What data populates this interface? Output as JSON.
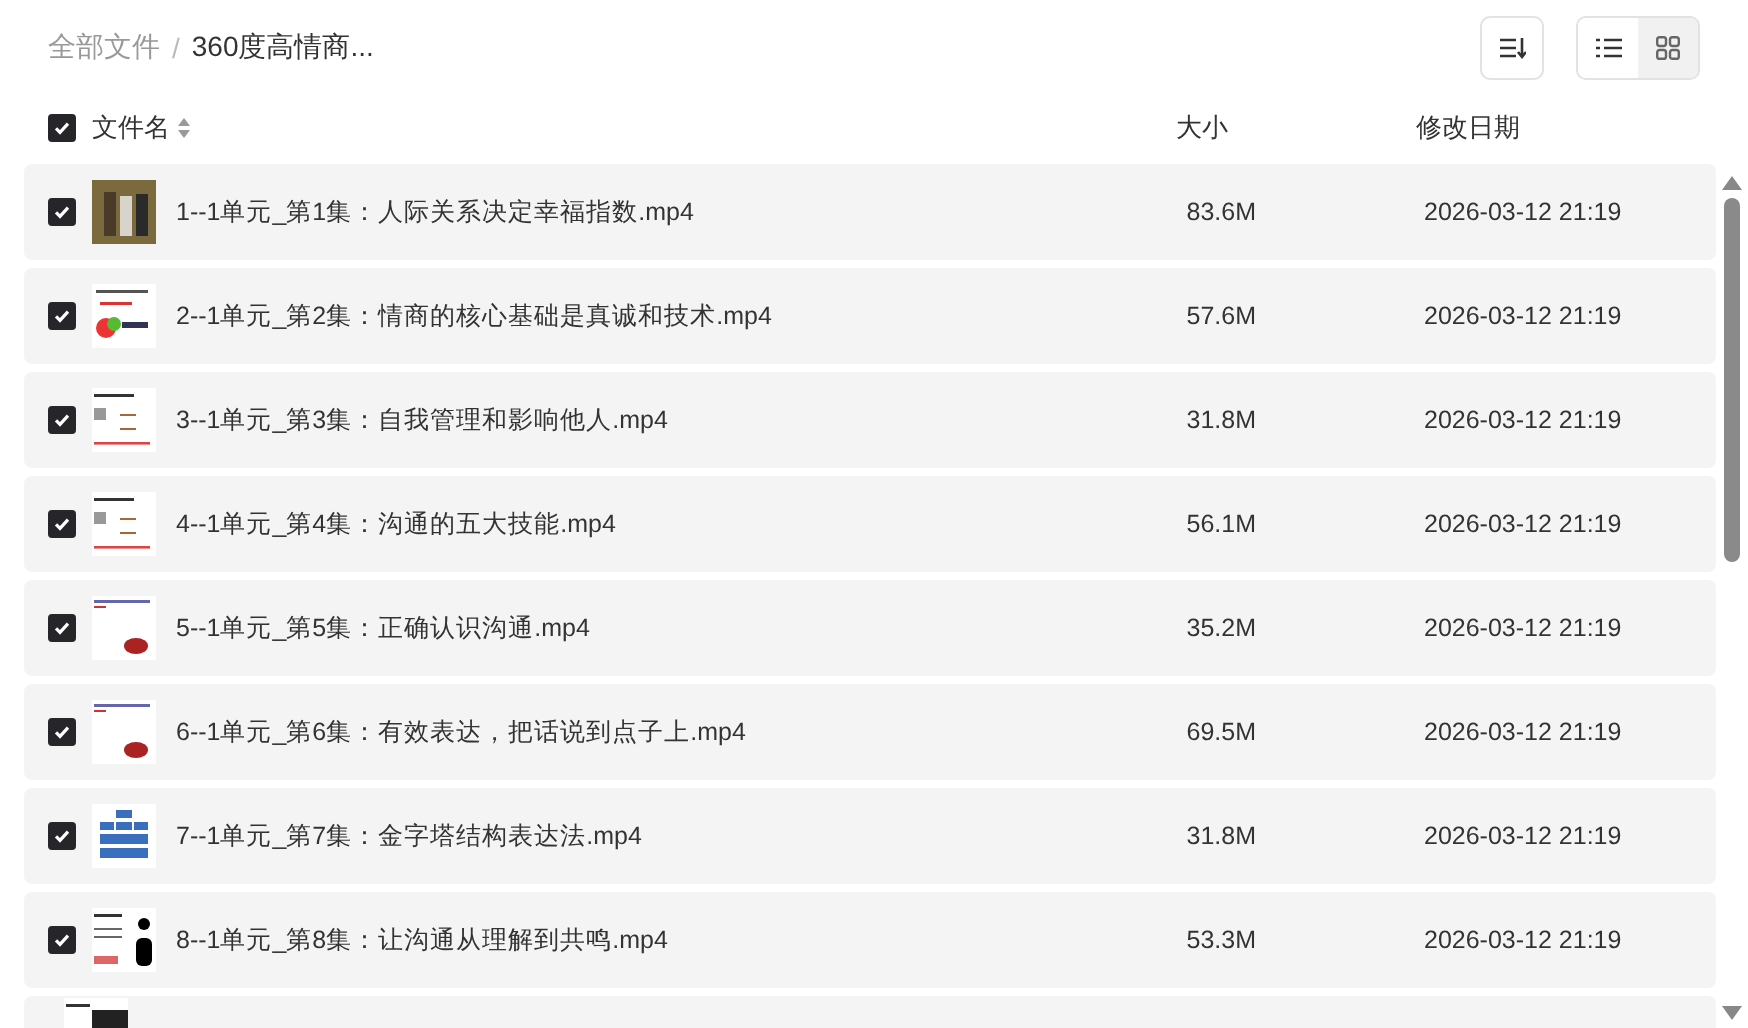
{
  "breadcrumb": [
    {
      "label": "全部文件",
      "current": false
    },
    {
      "label": "360度高情商...",
      "current": true
    }
  ],
  "breadcrumb_separator": "/",
  "view_toggle": [
    {
      "kind": "list",
      "selected": true
    },
    {
      "kind": "grid",
      "selected": false
    }
  ],
  "table": {
    "select_all": {
      "checked": true
    },
    "columns": [
      "文件名",
      "大小",
      "修改日期"
    ],
    "rows": [
      {
        "checked": true,
        "name": "1--1单元_第1集：人际关系决定幸福指数.mp4",
        "size": "83.6M",
        "modified": "2026-03-12 21:19"
      },
      {
        "checked": true,
        "name": "2--1单元_第2集：情商的核心基础是真诚和技术.mp4",
        "size": "57.6M",
        "modified": "2026-03-12 21:19"
      },
      {
        "checked": true,
        "name": "3--1单元_第3集：自我管理和影响他人.mp4",
        "size": "31.8M",
        "modified": "2026-03-12 21:19"
      },
      {
        "checked": true,
        "name": "4--1单元_第4集：沟通的五大技能.mp4",
        "size": "56.1M",
        "modified": "2026-03-12 21:19"
      },
      {
        "checked": true,
        "name": "5--1单元_第5集：正确认识沟通.mp4",
        "size": "35.2M",
        "modified": "2026-03-12 21:19"
      },
      {
        "checked": true,
        "name": "6--1单元_第6集：有效表达，把话说到点子上.mp4",
        "size": "69.5M",
        "modified": "2026-03-12 21:19"
      },
      {
        "checked": true,
        "name": "7--1单元_第7集：金字塔结构表达法.mp4",
        "size": "31.8M",
        "modified": "2026-03-12 21:19"
      },
      {
        "checked": true,
        "name": "8--1单元_第8集：让沟通从理解到共鸣.mp4",
        "size": "53.3M",
        "modified": "2026-03-12 21:19"
      }
    ]
  }
}
